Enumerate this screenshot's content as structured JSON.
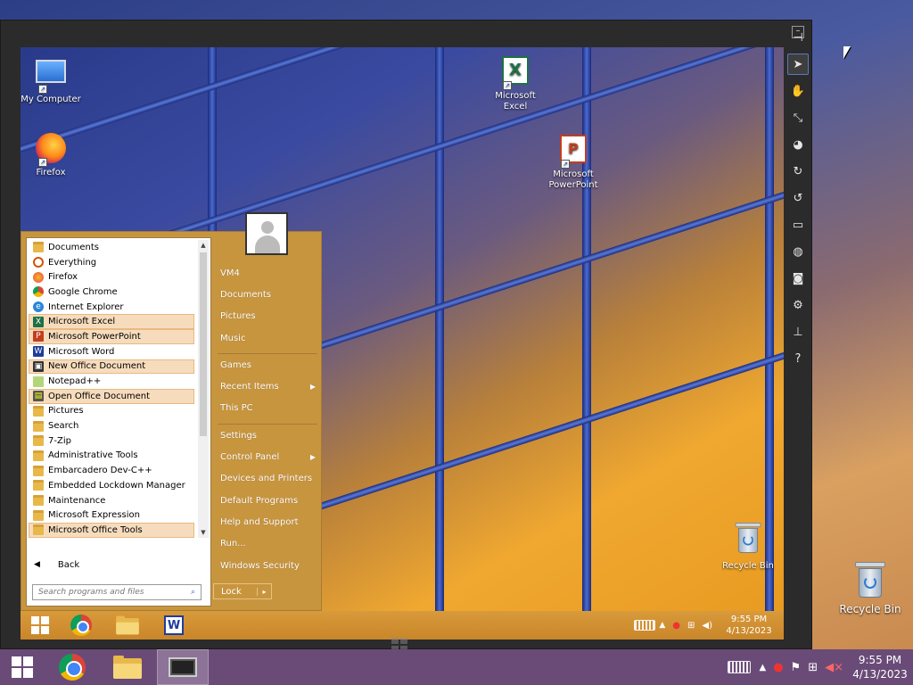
{
  "host": {
    "desktop_icons": [
      {
        "label": "Recycle Bin",
        "icon": "recycle-bin-icon"
      }
    ],
    "taskbar": {
      "buttons": [
        {
          "name": "start",
          "icon": "windows-logo-icon"
        },
        {
          "name": "chrome",
          "icon": "chrome-icon"
        },
        {
          "name": "file-explorer",
          "icon": "folder-icon"
        },
        {
          "name": "remote-desktop",
          "icon": "monitor-icon",
          "active": true
        }
      ],
      "time": "9:55 PM",
      "date": "4/13/2023"
    }
  },
  "vm": {
    "toolbar_tools": [
      "pin-icon",
      "pointer-icon",
      "hand-icon",
      "resize-icon",
      "gamepad-icon",
      "rotate-cw-icon",
      "rotate-ccw-icon",
      "display-icon",
      "globe-icon",
      "camera-icon",
      "gear-icon",
      "dock-icon",
      "help-icon"
    ],
    "desktop_icons": [
      {
        "label": "My Computer",
        "icon": "computer-icon"
      },
      {
        "label": "Firefox",
        "icon": "firefox-icon"
      },
      {
        "label": "Microsoft Excel",
        "icon": "excel-icon"
      },
      {
        "label": "Microsoft PowerPoint",
        "icon": "powerpoint-icon"
      },
      {
        "label": "Recycle Bin",
        "icon": "recycle-bin-icon"
      }
    ],
    "start_menu": {
      "programs": [
        {
          "label": "Documents",
          "icon": "folder-icon",
          "highlight": false
        },
        {
          "label": "Everything",
          "icon": "search-icon",
          "highlight": false
        },
        {
          "label": "Firefox",
          "icon": "firefox-icon",
          "highlight": false
        },
        {
          "label": "Google Chrome",
          "icon": "chrome-icon",
          "highlight": false
        },
        {
          "label": "Internet Explorer",
          "icon": "ie-icon",
          "highlight": false
        },
        {
          "label": "Microsoft Excel",
          "icon": "excel-icon",
          "highlight": true
        },
        {
          "label": "Microsoft PowerPoint",
          "icon": "powerpoint-icon",
          "highlight": true
        },
        {
          "label": "Microsoft Word",
          "icon": "word-icon",
          "highlight": false
        },
        {
          "label": "New Office Document",
          "icon": "office-icon",
          "highlight": true
        },
        {
          "label": "Notepad++",
          "icon": "notepad-icon",
          "highlight": false
        },
        {
          "label": "Open Office Document",
          "icon": "open-doc-icon",
          "highlight": true
        },
        {
          "label": "Pictures",
          "icon": "folder-icon",
          "highlight": false
        },
        {
          "label": "Search",
          "icon": "folder-icon",
          "highlight": false
        },
        {
          "label": "7-Zip",
          "icon": "folder-icon",
          "highlight": false
        },
        {
          "label": "Administrative Tools",
          "icon": "folder-icon",
          "highlight": false
        },
        {
          "label": "Embarcadero Dev-C++",
          "icon": "folder-icon",
          "highlight": false
        },
        {
          "label": "Embedded Lockdown Manager",
          "icon": "folder-icon",
          "highlight": false
        },
        {
          "label": "Maintenance",
          "icon": "folder-icon",
          "highlight": false
        },
        {
          "label": "Microsoft Expression",
          "icon": "folder-icon",
          "highlight": false
        },
        {
          "label": "Microsoft Office Tools",
          "icon": "folder-icon",
          "highlight": true
        }
      ],
      "back_label": "Back",
      "search_placeholder": "Search programs and files",
      "right_items": [
        {
          "label": "VM4",
          "submenu": false
        },
        {
          "label": "Documents",
          "submenu": false
        },
        {
          "label": "Pictures",
          "submenu": false
        },
        {
          "label": "Music",
          "submenu": false
        },
        {
          "separator": true
        },
        {
          "label": "Games",
          "submenu": false
        },
        {
          "label": "Recent Items",
          "submenu": true
        },
        {
          "label": "This PC",
          "submenu": false
        },
        {
          "separator": true
        },
        {
          "label": "Settings",
          "submenu": false
        },
        {
          "label": "Control Panel",
          "submenu": true
        },
        {
          "label": "Devices and Printers",
          "submenu": false
        },
        {
          "label": "Default Programs",
          "submenu": false
        },
        {
          "label": "Help and Support",
          "submenu": false
        },
        {
          "label": "Run...",
          "submenu": false
        },
        {
          "label": "Windows Security",
          "submenu": false
        }
      ],
      "lock_label": "Lock"
    },
    "taskbar": {
      "time": "9:55 PM",
      "date": "4/13/2023"
    }
  },
  "colors": {
    "start_menu_bg": "#c8953f",
    "highlight": "#f6dcbd",
    "host_taskbar": "#6a4b78"
  }
}
